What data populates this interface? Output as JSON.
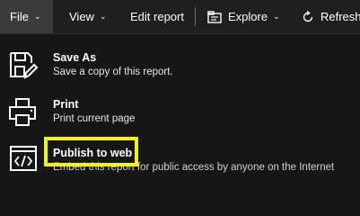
{
  "menubar": {
    "file_label": "File",
    "view_label": "View",
    "edit_report_label": "Edit report",
    "explore_label": "Explore",
    "refresh_label": "Refresh",
    "icons": [
      "chevron-down-icon",
      "explore-icon",
      "refresh-icon"
    ]
  },
  "file_menu": {
    "items": [
      {
        "title": "Save As",
        "description": "Save a copy of this report.",
        "icon": "save-as-icon"
      },
      {
        "title": "Print",
        "description": "Print current page",
        "icon": "printer-icon"
      },
      {
        "title": "Publish to web",
        "description": "Embed this report for public access by anyone on the Internet",
        "icon": "publish-web-icon"
      }
    ]
  },
  "colors": {
    "background": "#161616",
    "menubar": "#1f1f1f",
    "active_tab": "#3b3b3b",
    "highlight": "#f5f500"
  }
}
